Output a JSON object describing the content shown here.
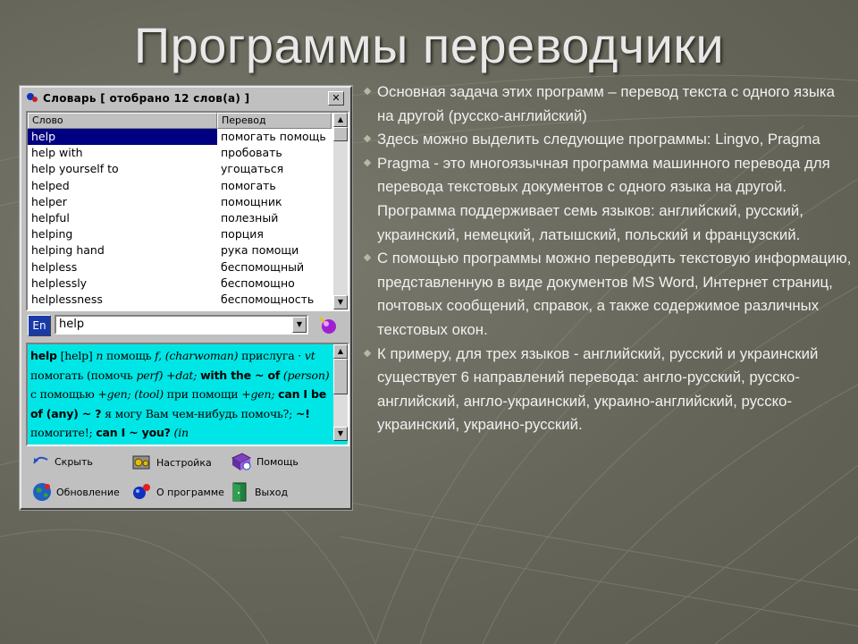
{
  "slide": {
    "title": "Программы переводчики",
    "bullets": [
      "Основная задача этих программ – перевод текста с одного языка на другой (русско-английский)",
      "Здесь можно выделить следующие программы: Lingvo, Pragma",
      "Pragma - это многоязычная программа машинного перевода для перевода текстовых документов с одного языка на другой. Программа поддерживает семь языков: английский, русский, украинский, немецкий, латышский, польский и французский.",
      " С помощью программы можно переводить текстовую информацию, представленную в виде документов MS Word, Интернет страниц, почтовых сообщений, справок, а также содержимое различных текстовых окон.",
      "К примеру, для трех языков - английский, русский и украинский существует 6 направлений перевода: англо-русский, русско-английский, англо-украинский, украино-английский, русско-украинский, украино-русский."
    ]
  },
  "window": {
    "title": "Словарь [ отобрано 12 слов(а) ]",
    "close_label": "✕",
    "columns": {
      "word": "Слово",
      "translation": "Перевод"
    },
    "rows": [
      {
        "word": "help",
        "translation": "помогать помощь",
        "selected": true
      },
      {
        "word": "help with",
        "translation": "пробовать"
      },
      {
        "word": "help yourself to",
        "translation": "угощаться"
      },
      {
        "word": "helped",
        "translation": "помогать"
      },
      {
        "word": "helper",
        "translation": "помощник"
      },
      {
        "word": "helpful",
        "translation": "полезный"
      },
      {
        "word": "helping",
        "translation": "порция"
      },
      {
        "word": "helping hand",
        "translation": "рука помощи"
      },
      {
        "word": "helpless",
        "translation": "беспомощный"
      },
      {
        "word": "helplessly",
        "translation": "беспомощно"
      },
      {
        "word": "helplessness",
        "translation": "беспомощность"
      }
    ],
    "lang_label": "En",
    "input_value": "help",
    "article": {
      "headword": "help",
      "transcription": "[help]",
      "pos_n": "n",
      "t1": "помощь",
      "g1": "f,",
      "c1": "(charwoman)",
      "t2": "прислуга",
      "pos_vt": "vt",
      "t3": "помогать (помочь",
      "perf": "perf)",
      "dat": "+dat;",
      "p1": "with the ~ of",
      "person": "(person)",
      "t4": "с помощью",
      "gen1": "+gen;",
      "tool": "(tool)",
      "t5": "при помощи",
      "gen2": "+gen;",
      "p2": "can I be of (any) ~ ?",
      "t6": "я могу Вам чем-нибудь помочь?;",
      "p3": "~!",
      "t7": "помогите!;",
      "p4": "can I ~ you?",
      "in": "(in"
    },
    "buttons": {
      "hide": "Скрыть",
      "settings": "Настройка",
      "help": "Помощь",
      "update": "Обновление",
      "about": "О программе",
      "exit": "Выход"
    }
  }
}
